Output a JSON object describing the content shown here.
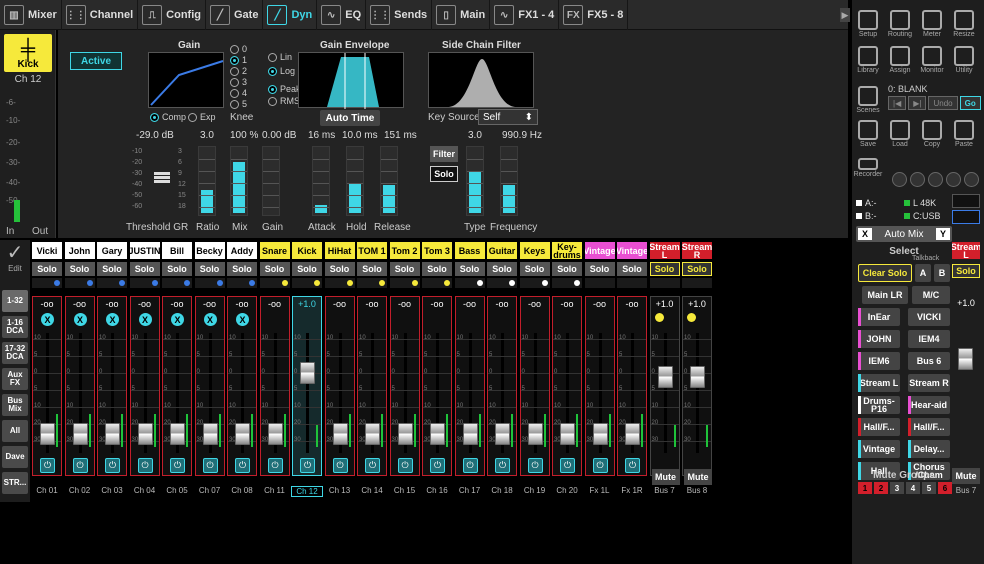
{
  "tabs": [
    {
      "label": "Mixer",
      "icon": "mixer-icon",
      "glyph": "▥"
    },
    {
      "label": "Channel",
      "icon": "channel-icon",
      "glyph": "⋮⋮"
    },
    {
      "label": "Config",
      "icon": "config-icon",
      "glyph": "⎍"
    },
    {
      "label": "Gate",
      "icon": "gate-icon",
      "glyph": "╱"
    },
    {
      "label": "Dyn",
      "icon": "dyn-icon",
      "glyph": "╱"
    },
    {
      "label": "EQ",
      "icon": "eq-icon",
      "glyph": "∿"
    },
    {
      "label": "Sends",
      "icon": "sends-icon",
      "glyph": "⋮⋮"
    },
    {
      "label": "Main",
      "icon": "main-icon",
      "glyph": "▯"
    },
    {
      "label": "FX1 - 4",
      "icon": "fx1-icon",
      "glyph": "∿"
    },
    {
      "label": "FX5 - 8",
      "icon": "fx5-icon",
      "glyph": "FX"
    }
  ],
  "kick": {
    "name": "Kick",
    "ch": "Ch 12",
    "in": "In",
    "out": "Out",
    "scale": [
      "-6-",
      "-10-",
      "-20-",
      "-30-",
      "-40-",
      "-50-"
    ]
  },
  "dyn": {
    "active": "Active",
    "gain_title": "Gain",
    "env_title": "Gain Envelope",
    "sc_title": "Side Chain Filter",
    "knee_options": [
      "0",
      "1",
      "2",
      "3",
      "4",
      "5"
    ],
    "knee_label": "Knee",
    "comp": "Comp",
    "exp": "Exp",
    "lin": "Lin",
    "log": "Log",
    "peak": "Peak",
    "rms": "RMS",
    "auto_time": "Auto Time",
    "key_source_label": "Key Source",
    "key_source_value": "Self",
    "filter": "Filter",
    "solo": "Solo",
    "values": {
      "threshold": "-29.0 dB",
      "ratio": "3.0",
      "mix": "100 %",
      "gain": "0.00 dB",
      "attack": "16 ms",
      "hold": "10.0 ms",
      "release": "151 ms",
      "type": "3.0",
      "frequency": "990.9 Hz"
    },
    "labels": {
      "threshold_gr": "Threshold GR",
      "ratio": "Ratio",
      "mix": "Mix",
      "gain": "Gain",
      "attack": "Attack",
      "hold": "Hold",
      "release": "Release",
      "type": "Type",
      "frequency": "Frequency"
    },
    "meter_scale": [
      "-10",
      "-20",
      "-30",
      "-40",
      "-50",
      "-60"
    ],
    "gr_scale": [
      "3",
      "6",
      "9",
      "12",
      "15",
      "18"
    ],
    "levels": {
      "ratio": 0.35,
      "mix": 0.78,
      "gain": 0.0,
      "attack": 0.12,
      "hold": 0.45,
      "release": 0.42,
      "type": 0.62,
      "frequency": 0.42
    }
  },
  "nav": {
    "edit": "Edit",
    "buttons": [
      "1-32",
      "1-16 DCA",
      "17-32 DCA",
      "Aux FX",
      "Bus Mix",
      "All",
      "Dave",
      "STR..."
    ]
  },
  "strips": [
    {
      "name": "Vicki",
      "ch": "Ch 01",
      "gain": "-oo",
      "mute": "X",
      "fader": 0.18,
      "meter": 0.3,
      "color": "#ffffff",
      "body": "red",
      "solo_lit": false,
      "ind": "blue"
    },
    {
      "name": "John",
      "ch": "Ch 02",
      "gain": "-oo",
      "mute": "X",
      "fader": 0.18,
      "meter": 0.3,
      "color": "#ffffff",
      "body": "red",
      "solo_lit": false,
      "ind": "blue"
    },
    {
      "name": "Gary",
      "ch": "Ch 03",
      "gain": "-oo",
      "mute": "X",
      "fader": 0.18,
      "meter": 0.3,
      "color": "#ffffff",
      "body": "red",
      "solo_lit": false,
      "ind": "blue"
    },
    {
      "name": "JUSTIN",
      "ch": "Ch 04",
      "gain": "-oo",
      "mute": "X",
      "fader": 0.18,
      "meter": 0.3,
      "color": "#ffffff",
      "body": "red",
      "solo_lit": false,
      "ind": "blue"
    },
    {
      "name": "Bill",
      "ch": "Ch 05",
      "gain": "-oo",
      "mute": "X",
      "fader": 0.18,
      "meter": 0.3,
      "color": "#ffffff",
      "body": "red",
      "solo_lit": false,
      "ind": "blue"
    },
    {
      "name": "Becky",
      "ch": "Ch 07",
      "gain": "-oo",
      "mute": "X",
      "fader": 0.18,
      "meter": 0.3,
      "color": "#ffffff",
      "body": "red",
      "solo_lit": false,
      "ind": "blue"
    },
    {
      "name": "Addy",
      "ch": "Ch 08",
      "gain": "-oo",
      "mute": "X",
      "fader": 0.18,
      "meter": 0.3,
      "color": "#ffffff",
      "body": "red",
      "solo_lit": false,
      "ind": "blue"
    },
    {
      "name": "Snare",
      "ch": "Ch 11",
      "gain": "-oo",
      "mute": "",
      "fader": 0.18,
      "meter": 0.3,
      "color": "#f6e93b",
      "body": "red",
      "solo_lit": false,
      "ind": "yel"
    },
    {
      "name": "Kick",
      "ch": "Ch 12",
      "gain": "+1.0",
      "mute": "",
      "fader": 0.74,
      "meter": 0.2,
      "color": "#f6e93b",
      "body": "kick",
      "solo_lit": false,
      "ind": "yel"
    },
    {
      "name": "HiHat",
      "ch": "Ch 13",
      "gain": "-oo",
      "mute": "",
      "fader": 0.18,
      "meter": 0.3,
      "color": "#f6e93b",
      "body": "red",
      "solo_lit": false,
      "ind": "yel"
    },
    {
      "name": "TOM 1",
      "ch": "Ch 14",
      "gain": "-oo",
      "mute": "",
      "fader": 0.18,
      "meter": 0.3,
      "color": "#f6e93b",
      "body": "red",
      "solo_lit": false,
      "ind": "yel"
    },
    {
      "name": "Tom 2",
      "ch": "Ch 15",
      "gain": "-oo",
      "mute": "",
      "fader": 0.18,
      "meter": 0.3,
      "color": "#f6e93b",
      "body": "red",
      "solo_lit": false,
      "ind": "yel"
    },
    {
      "name": "Tom 3",
      "ch": "Ch 16",
      "gain": "-oo",
      "mute": "",
      "fader": 0.18,
      "meter": 0.3,
      "color": "#f6e93b",
      "body": "red",
      "solo_lit": false,
      "ind": "yel"
    },
    {
      "name": "Bass",
      "ch": "Ch 17",
      "gain": "-oo",
      "mute": "",
      "fader": 0.18,
      "meter": 0.3,
      "color": "#f6e93b",
      "body": "red",
      "solo_lit": false,
      "ind": "w"
    },
    {
      "name": "Guitar",
      "ch": "Ch 18",
      "gain": "-oo",
      "mute": "",
      "fader": 0.18,
      "meter": 0.3,
      "color": "#f6e93b",
      "body": "red",
      "solo_lit": false,
      "ind": "w"
    },
    {
      "name": "Keys",
      "ch": "Ch 19",
      "gain": "-oo",
      "mute": "",
      "fader": 0.18,
      "meter": 0.3,
      "color": "#f6e93b",
      "body": "red",
      "solo_lit": false,
      "ind": "w"
    },
    {
      "name": "Key-drums",
      "ch": "Ch 20",
      "gain": "-oo",
      "mute": "",
      "fader": 0.18,
      "meter": 0.3,
      "color": "#f6e93b",
      "body": "red",
      "solo_lit": false,
      "ind": "w"
    },
    {
      "name": "Vintage",
      "ch": "Fx 1L",
      "gain": "-oo",
      "mute": "",
      "fader": 0.18,
      "meter": 0.3,
      "color": "#e94fd2",
      "body": "red",
      "solo_lit": false,
      "ind": ""
    },
    {
      "name": "Vintage",
      "ch": "Fx 1R",
      "gain": "-oo",
      "mute": "",
      "fader": 0.18,
      "meter": 0.3,
      "color": "#e94fd2",
      "body": "red",
      "solo_lit": false,
      "ind": ""
    },
    {
      "name": "Stream L",
      "ch": "Bus 7",
      "gain": "+1.0",
      "mute": "Mute",
      "fader": 0.7,
      "meter": 0.2,
      "color": "#d21f2b",
      "body": "bus",
      "solo_lit": true,
      "ind": ""
    },
    {
      "name": "Stream R",
      "ch": "Bus 8",
      "gain": "+1.0",
      "mute": "Mute",
      "fader": 0.7,
      "meter": 0.2,
      "color": "#d21f2b",
      "body": "bus",
      "solo_lit": true,
      "ind": ""
    }
  ],
  "solo_label": "Solo",
  "fader_scale": [
    "10",
    "5",
    "0",
    "5",
    "10",
    "20",
    "30"
  ],
  "right": {
    "top_buttons": [
      "Setup",
      "Routing",
      "Meter",
      "Resize",
      "Library",
      "Assign",
      "Monitor",
      "Utility"
    ],
    "scenes_label": "Scenes",
    "blank": "0: BLANK",
    "undo": "Undo",
    "go": "Go",
    "file_buttons": [
      "Save",
      "Load",
      "Copy",
      "Paste"
    ],
    "recorder": "Recorder",
    "src_a": "A:-",
    "src_b": "B:-",
    "src_l": "L  48K",
    "src_c": "C:USB",
    "automix": "Auto Mix",
    "automix_x": "X",
    "automix_y": "Y",
    "select": "Select",
    "talkback": "Talkback",
    "clear_solo": "Clear Solo",
    "a": "A",
    "b": "B",
    "main_lr": "Main LR",
    "mc": "M/C",
    "routes": [
      {
        "label": "InEar",
        "stripe": "#e94fd2"
      },
      {
        "label": "VICKI",
        "stripe": ""
      },
      {
        "label": "JOHN",
        "stripe": "#e94fd2"
      },
      {
        "label": "IEM4",
        "stripe": ""
      },
      {
        "label": "IEM6",
        "stripe": "#e94fd2"
      },
      {
        "label": "Bus 6",
        "stripe": ""
      },
      {
        "label": "Stream L",
        "stripe": "#3fd7e6"
      },
      {
        "label": "Stream R",
        "stripe": ""
      },
      {
        "label": "Drums-P16",
        "stripe": "#fff"
      },
      {
        "label": "Hear-aid",
        "stripe": "#e94fd2"
      },
      {
        "label": "Hall/F...",
        "stripe": "#d21f2b"
      },
      {
        "label": "Hall/F...",
        "stripe": "#d21f2b"
      },
      {
        "label": "Vintage",
        "stripe": "#3fd7e6"
      },
      {
        "label": "Delay...",
        "stripe": "#3fd7e6"
      },
      {
        "label": "Hall",
        "stripe": "#3fd7e6"
      },
      {
        "label": "Chorus /Cham",
        "stripe": "#3fd7e6"
      }
    ],
    "mute_groups": "Mute Groups",
    "mg": [
      "1",
      "2",
      "3",
      "4",
      "5",
      "6"
    ],
    "mini_strip": {
      "name": "Stream L",
      "solo": "Solo",
      "gain": "+1.0",
      "mute": "Mute",
      "ch": "Bus 7"
    }
  }
}
